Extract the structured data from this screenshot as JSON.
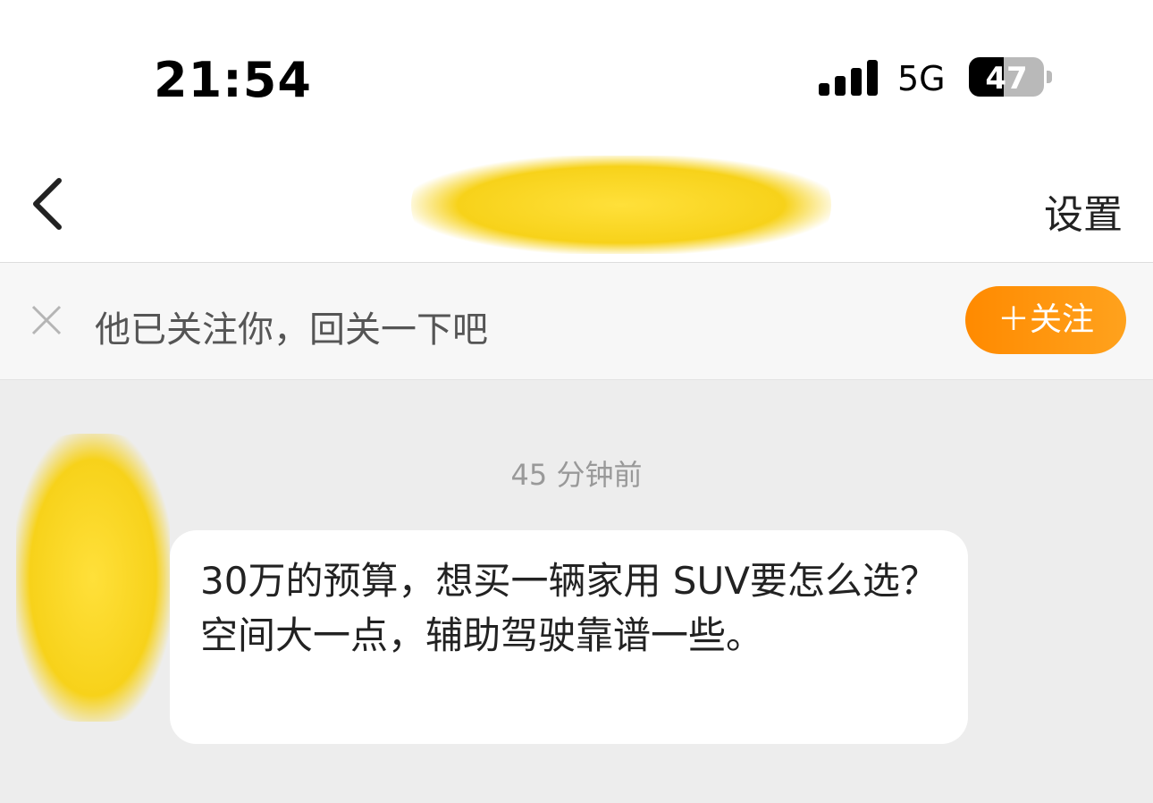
{
  "status_bar": {
    "time": "21:54",
    "network": "5G",
    "battery_level": "47",
    "battery_fraction": 0.47
  },
  "nav": {
    "title": "",
    "settings_label": "设置",
    "back_icon": "chevron-left-icon"
  },
  "follow_banner": {
    "text": "他已关注你，回关一下吧",
    "button_label": "＋关注",
    "dismiss_icon": "close-icon",
    "accent_color": "#ff8a00"
  },
  "chat": {
    "timestamp": "45 分钟前",
    "messages": [
      {
        "sender": "other",
        "text": "30万的预算，想买一辆家用 SUV要怎么选？空间大一点，辅助驾驶靠谱一些。"
      }
    ]
  },
  "colors": {
    "background": "#ededed",
    "bubble": "#ffffff",
    "redaction": "#f7d21a"
  }
}
